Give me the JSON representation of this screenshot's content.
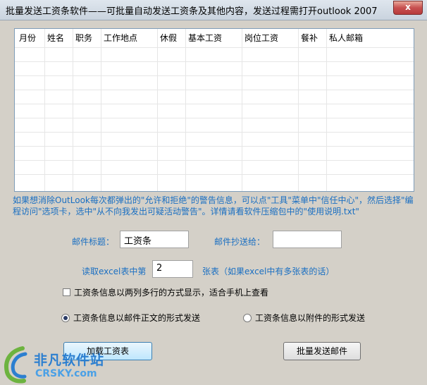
{
  "window": {
    "title": "批量发送工资条软件——可批量自动发送工资条及其他内容，发送过程需打开outlook 2007",
    "close_glyph": "x"
  },
  "grid": {
    "columns": [
      "月份",
      "姓名",
      "职务",
      "工作地点",
      "休假",
      "基本工资",
      "岗位工资",
      "餐补",
      "私人邮箱"
    ]
  },
  "hint": "如果想消除OutLook每次都弹出的\"允许和拒绝\"的警告信息，可以点\"工具\"菜单中\"信任中心\"，然后选择\"编程访问\"选项卡，选中\"从不向我发出可疑活动警告\"。详情请看软件压缩包中的\"使用说明.txt\"",
  "form": {
    "subject_label": "邮件标题：",
    "subject_value": "工资条",
    "cc_label": "邮件抄送给：",
    "cc_value": "",
    "sheet_prefix": "读取excel表中第",
    "sheet_value": "2",
    "sheet_suffix": "张表（如果excel中有多张表的话）",
    "two_column_label": "工资条信息以两列多行的方式显示，适合手机上查看",
    "radio_body_label": "工资条信息以邮件正文的形式发送",
    "radio_attachment_label": "工资条信息以附件的形式发送"
  },
  "buttons": {
    "load": "加载工资表",
    "send": "批量发送邮件"
  },
  "watermark": {
    "cn": "非凡软件站",
    "en": "CRSKY.com"
  },
  "colors": {
    "hint_blue": "#1a6fc2",
    "background": "#d4d0c8"
  }
}
